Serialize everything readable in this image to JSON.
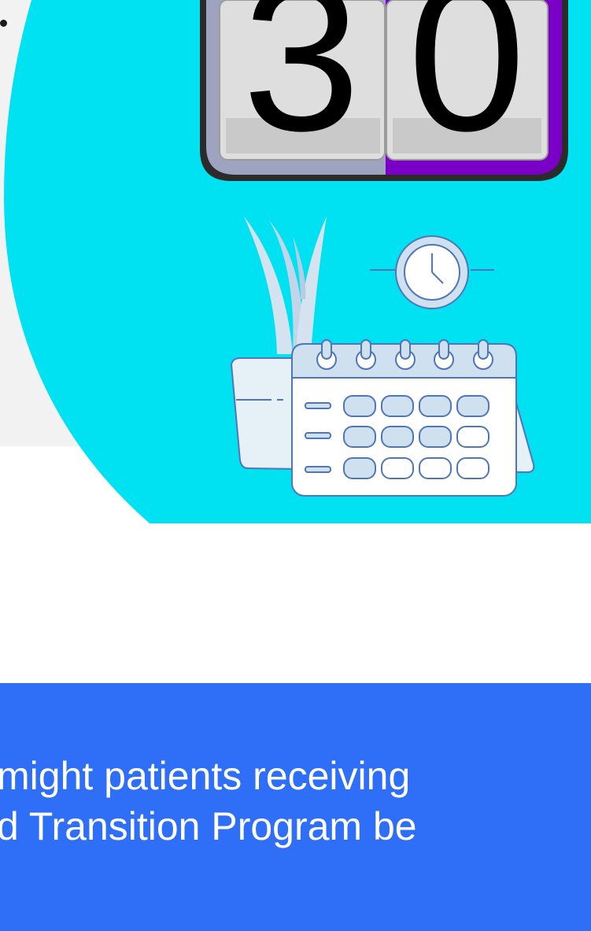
{
  "hero": {
    "counter_digits": [
      "3",
      "0"
    ],
    "colors": {
      "circle": "#00e2f2",
      "counter_frame_left": "#9ea3bf",
      "counter_frame_right": "#7a00c8",
      "calendar_outline": "#4f76b8",
      "calendar_fill": "#cfe0ef",
      "plant_leaf": "#d5e3f0"
    },
    "icons": [
      "flip-counter-icon",
      "plant-pot-icon",
      "clock-icon",
      "calendar-icon"
    ]
  },
  "question": {
    "lines": [
      "might patients receiving",
      "d Transition Program be"
    ],
    "background": "#2f6ef6"
  }
}
